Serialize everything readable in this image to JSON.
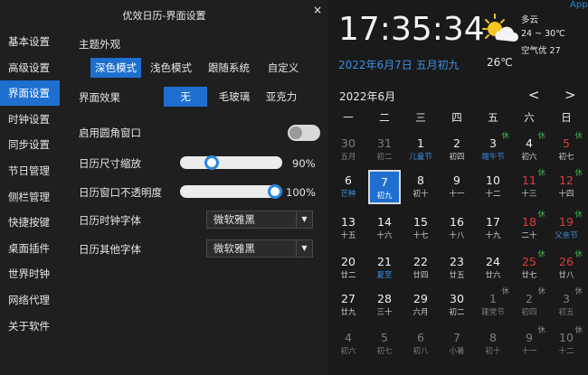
{
  "window": {
    "title": "优效日历-界面设置",
    "close": "×"
  },
  "sidebar": [
    {
      "label": "基本设置",
      "active": false
    },
    {
      "label": "高级设置",
      "active": false
    },
    {
      "label": "界面设置",
      "active": true
    },
    {
      "label": "时钟设置",
      "active": false
    },
    {
      "label": "同步设置",
      "active": false
    },
    {
      "label": "节日管理",
      "active": false
    },
    {
      "label": "侧栏管理",
      "active": false
    },
    {
      "label": "快捷按键",
      "active": false
    },
    {
      "label": "桌面插件",
      "active": false
    },
    {
      "label": "世界时钟",
      "active": false
    },
    {
      "label": "网络代理",
      "active": false
    },
    {
      "label": "关于软件",
      "active": false
    }
  ],
  "settings": {
    "theme_label": "主题外观",
    "theme_options": [
      "深色模式",
      "浅色模式",
      "跟随系统",
      "自定义"
    ],
    "theme_selected": 0,
    "effect_label": "界面效果",
    "effect_options": [
      "无",
      "毛玻璃",
      "亚克力"
    ],
    "effect_selected": 0,
    "rounded_label": "启用圆角窗口",
    "rounded_enabled": false,
    "scale_label": "日历尺寸缩放",
    "scale_value": "90%",
    "scale_fraction": 0.28,
    "opacity_label": "日历窗口不透明度",
    "opacity_value": "100%",
    "opacity_fraction": 1.0,
    "clock_font_label": "日历时钟字体",
    "clock_font_value": "微软雅黑",
    "other_font_label": "日历其他字体",
    "other_font_value": "微软雅黑"
  },
  "calendar": {
    "app_label": "App",
    "time": "17:35:34",
    "weather": {
      "condition": "多云",
      "range": "24 ~ 30℃",
      "air": "空气优 27",
      "temp": "26℃",
      "icon": "partly-cloudy-icon"
    },
    "date_text": "2022年6月7日 五月初九",
    "month_label": "2022年6月",
    "prev": "<",
    "next": ">",
    "weekdays": [
      "一",
      "二",
      "三",
      "四",
      "五",
      "六",
      "日"
    ],
    "weeks": [
      [
        {
          "d": "30",
          "l": "五月",
          "dim": true
        },
        {
          "d": "31",
          "l": "初二",
          "dim": true
        },
        {
          "d": "1",
          "l": "儿童节",
          "lc": "blue"
        },
        {
          "d": "2",
          "l": "初四"
        },
        {
          "d": "3",
          "l": "端午节",
          "lc": "blue",
          "badge": "休"
        },
        {
          "d": "4",
          "l": "初六",
          "badge": "休"
        },
        {
          "d": "5",
          "l": "初七",
          "dc": "red",
          "badge": "休"
        }
      ],
      [
        {
          "d": "6",
          "l": "芒种",
          "lc": "blue"
        },
        {
          "d": "7",
          "l": "初九",
          "today": true
        },
        {
          "d": "8",
          "l": "初十"
        },
        {
          "d": "9",
          "l": "十一"
        },
        {
          "d": "10",
          "l": "十二"
        },
        {
          "d": "11",
          "l": "十三",
          "dc": "red",
          "badge": "休"
        },
        {
          "d": "12",
          "l": "十四",
          "dc": "red",
          "badge": "休"
        }
      ],
      [
        {
          "d": "13",
          "l": "十五"
        },
        {
          "d": "14",
          "l": "十六"
        },
        {
          "d": "15",
          "l": "十七"
        },
        {
          "d": "16",
          "l": "十八"
        },
        {
          "d": "17",
          "l": "十九"
        },
        {
          "d": "18",
          "l": "二十",
          "dc": "red",
          "badge": "休"
        },
        {
          "d": "19",
          "l": "父亲节",
          "dc": "red",
          "lc": "blue",
          "badge": "休"
        }
      ],
      [
        {
          "d": "20",
          "l": "廿二"
        },
        {
          "d": "21",
          "l": "夏至",
          "lc": "blue"
        },
        {
          "d": "22",
          "l": "廿四"
        },
        {
          "d": "23",
          "l": "廿五"
        },
        {
          "d": "24",
          "l": "廿六"
        },
        {
          "d": "25",
          "l": "廿七",
          "dc": "red",
          "badge": "休"
        },
        {
          "d": "26",
          "l": "廿八",
          "dc": "red",
          "badge": "休"
        }
      ],
      [
        {
          "d": "27",
          "l": "廿九"
        },
        {
          "d": "28",
          "l": "三十"
        },
        {
          "d": "29",
          "l": "六月"
        },
        {
          "d": "30",
          "l": "初二"
        },
        {
          "d": "1",
          "l": "建党节",
          "dim": true,
          "badge": "休",
          "bc": "gray"
        },
        {
          "d": "2",
          "l": "初四",
          "dim": true,
          "badge": "休",
          "bc": "gray"
        },
        {
          "d": "3",
          "l": "初五",
          "dim": true,
          "badge": "休",
          "bc": "gray"
        }
      ],
      [
        {
          "d": "4",
          "l": "初六",
          "dim": true
        },
        {
          "d": "5",
          "l": "初七",
          "dim": true
        },
        {
          "d": "6",
          "l": "初八",
          "dim": true
        },
        {
          "d": "7",
          "l": "小暑",
          "dim": true
        },
        {
          "d": "8",
          "l": "初十",
          "dim": true
        },
        {
          "d": "9",
          "l": "十一",
          "dim": true,
          "badge": "休",
          "bc": "gray"
        },
        {
          "d": "10",
          "l": "十二",
          "dim": true,
          "badge": "休",
          "bc": "gray"
        }
      ]
    ]
  }
}
